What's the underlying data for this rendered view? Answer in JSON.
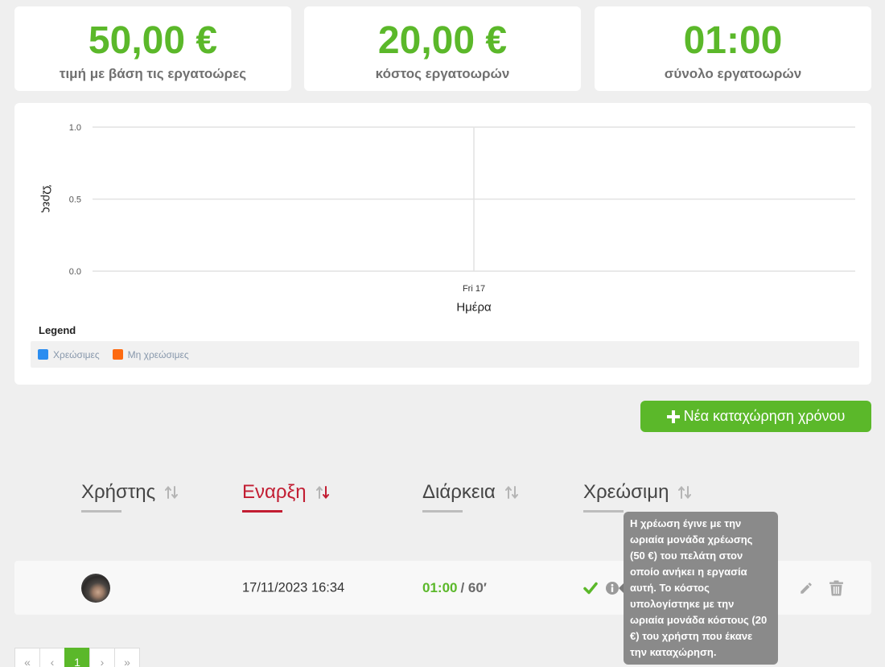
{
  "stats": [
    {
      "value": "50,00 €",
      "label": "τιμή με βάση τις εργατοώρες"
    },
    {
      "value": "20,00 €",
      "label": "κόστος εργατοωρών"
    },
    {
      "value": "01:00",
      "label": "σύνολο εργατοωρών"
    }
  ],
  "chart_data": {
    "type": "bar",
    "categories": [
      "Fri 17"
    ],
    "xlabel": "Ημέρα",
    "ylabel": "Ώρες",
    "ylim": [
      0,
      1
    ],
    "yticks": [
      "0.0",
      "0.5",
      "1.0"
    ],
    "grid": true,
    "legend": {
      "title": "Legend",
      "placement": "bottom"
    },
    "series": [
      {
        "name": "Χρεώσιμες",
        "color": "#2b8df0",
        "values": []
      },
      {
        "name": "Μη χρεώσιμες",
        "color": "#fd6a10",
        "values": []
      }
    ]
  },
  "actions": {
    "new_entry": {
      "icon": "plus-icon",
      "label": "Νέα καταχώρηση χρόνου"
    }
  },
  "table": {
    "columns": [
      {
        "label": "Χρήστης",
        "sort": "none",
        "active": false
      },
      {
        "label": "Εναρξη",
        "sort": "desc",
        "active": true
      },
      {
        "label": "Διάρκεια",
        "sort": "none",
        "active": false
      },
      {
        "label": "Χρεώσιμη",
        "sort": "none",
        "active": false
      }
    ],
    "rows": [
      {
        "avatar": "user-avatar",
        "start": "17/11/2023 16:34",
        "duration": "01:00",
        "duration_total": "/ 60′",
        "billable": true,
        "billable_icon": "check-icon",
        "info_icon": "info-icon",
        "edit_icon": "pencil-icon",
        "delete_icon": "trash-icon"
      }
    ]
  },
  "tooltip": {
    "lines": [
      "Η χρέωση έγινε με την",
      "ωριαία μονάδα χρέωσης",
      "(50 €) του πελάτη στον",
      "οποίο ανήκει η εργασία",
      "αυτή. Το κόστος",
      "υπολογίστηκε με την",
      "ωριαία μονάδα κόστους (20",
      "€) του χρήστη που έκανε",
      "την καταχώρηση."
    ]
  },
  "pagination": {
    "first": "«",
    "prev": "‹",
    "current": "1",
    "next": "›",
    "last": "»"
  },
  "colors": {
    "accent_green": "#5bb82a",
    "active_red": "#c21d32",
    "muted": "#b5b5b5"
  }
}
